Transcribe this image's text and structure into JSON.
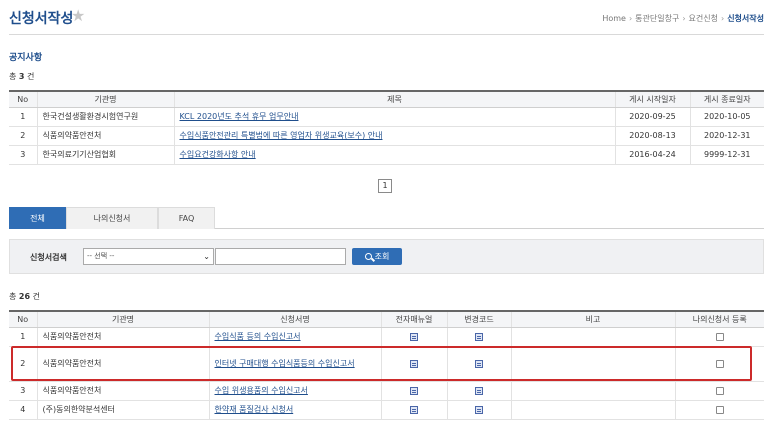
{
  "header": {
    "title": "신청서작성",
    "star_icon": "star-icon",
    "breadcrumb": [
      "Home",
      "통관단일창구",
      "요건신청",
      "신청서작성"
    ]
  },
  "notice": {
    "title": "공지사항",
    "count_prefix": "총",
    "count": "3",
    "count_suffix": "건",
    "columns": [
      "No",
      "기관명",
      "제목",
      "게시 시작일자",
      "게시 종료일자"
    ],
    "rows": [
      {
        "no": "1",
        "org": "한국건설생활환경시험연구원",
        "title": "KCL 2020년도 추석 휴무 업무안내",
        "start": "2020-09-25",
        "end": "2020-10-05"
      },
      {
        "no": "2",
        "org": "식품의약품안전처",
        "title": "수입식품안전관리 특별법에 따른 영업자 위생교육(보수) 안내",
        "start": "2020-08-13",
        "end": "2020-12-31"
      },
      {
        "no": "3",
        "org": "한국의료기기산업협회",
        "title": "수입요건강화사항 안내",
        "start": "2016-04-24",
        "end": "9999-12-31"
      }
    ],
    "page": "1"
  },
  "tabs": [
    {
      "label": "전체",
      "active": true
    },
    {
      "label": "나의신청서",
      "active": false
    },
    {
      "label": "FAQ",
      "active": false
    }
  ],
  "search": {
    "label": "신청서검색",
    "select_value": "-- 선택 --",
    "input_value": "",
    "button_label": "조회"
  },
  "apps": {
    "count_prefix": "총",
    "count": "26",
    "count_suffix": "건",
    "columns": [
      "No",
      "기관명",
      "신청서명",
      "전자매뉴얼",
      "변경코드",
      "비고",
      "나의신청서 등록"
    ],
    "rows": [
      {
        "no": "1",
        "org": "식품의약품안전처",
        "name": "수입식품 등의 수입신고서",
        "note": ""
      },
      {
        "no": "2",
        "org": "식품의약품안전처",
        "name": "인터넷 구매대행 수입식품등의 수입신고서",
        "note": ""
      },
      {
        "no": "3",
        "org": "식품의약품안전처",
        "name": "수입 위생용품의 수입신고서",
        "note": ""
      },
      {
        "no": "4",
        "org": "(주)동의한약분석센터",
        "name": "한약재 품질검사 신청서",
        "note": ""
      }
    ]
  },
  "colors": {
    "accent": "#2f6db5",
    "title": "#1f4e8c",
    "highlight": "#cc2a2a"
  }
}
